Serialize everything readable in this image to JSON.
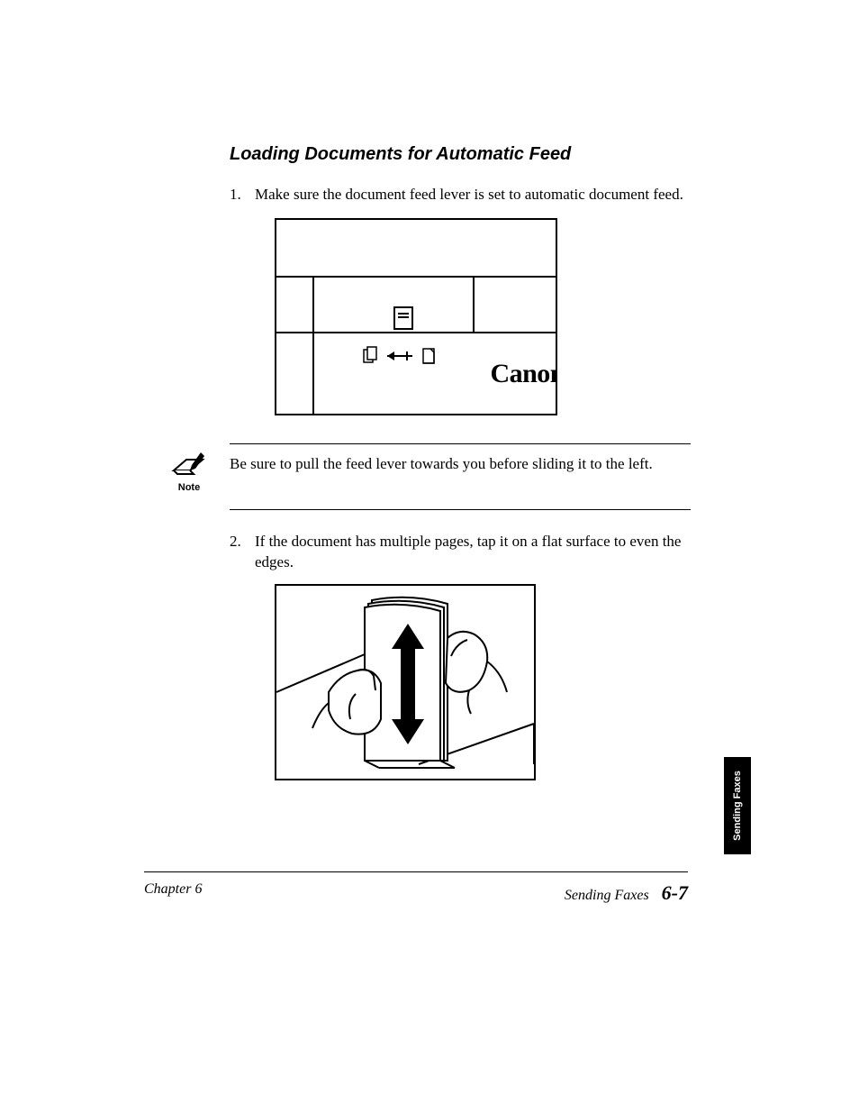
{
  "heading": "Loading Documents for Automatic Feed",
  "steps": [
    {
      "num": "1.",
      "text": "Make sure the document feed lever is set to automatic document feed."
    },
    {
      "num": "2.",
      "text": "If the document has multiple pages, tap it on a flat surface to even the edges."
    }
  ],
  "figure1": {
    "brand": "Canon",
    "icon_multi": "⿻",
    "arrow": "←",
    "icon_single": "▭"
  },
  "note": {
    "label": "Note",
    "text": "Be sure to pull the feed lever towards you before sliding it to the left."
  },
  "side_tab": "Sending Faxes",
  "footer": {
    "left": "Chapter 6",
    "right_label": "Sending Faxes",
    "page": "6-7"
  }
}
